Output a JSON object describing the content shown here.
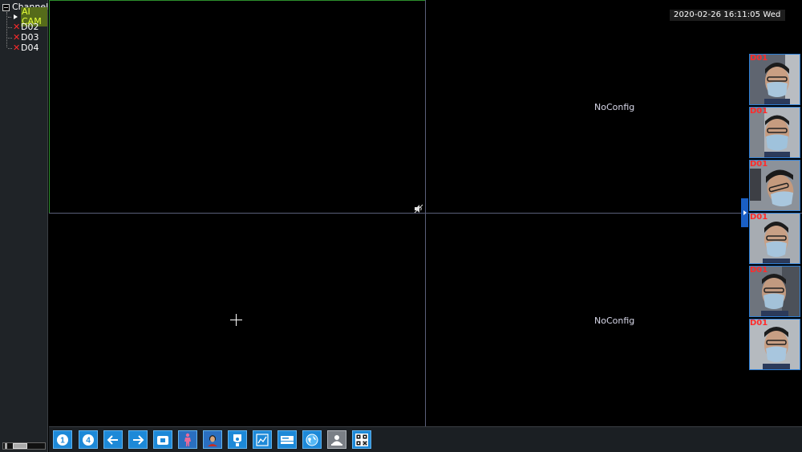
{
  "sidebar": {
    "root_label": "Channel",
    "items": [
      {
        "label": "AI CAM",
        "status": "active"
      },
      {
        "label": "D02",
        "status": "offline"
      },
      {
        "label": "D03",
        "status": "offline"
      },
      {
        "label": "D04",
        "status": "offline"
      }
    ]
  },
  "overlay": {
    "datetime": "2020-02-26 16:11:05 Wed"
  },
  "panes": {
    "top_right": "NoConfig",
    "bottom_right": "NoConfig"
  },
  "faces": [
    {
      "label": "D01"
    },
    {
      "label": "D01"
    },
    {
      "label": "D01"
    },
    {
      "label": "D01"
    },
    {
      "label": "D01"
    },
    {
      "label": "D01"
    }
  ],
  "toolbar": {
    "buttons": [
      {
        "name": "single-view-button",
        "text": "1"
      },
      {
        "name": "quad-view-button",
        "text": "4"
      },
      {
        "name": "previous-button",
        "icon": "arrow-left-icon"
      },
      {
        "name": "next-button",
        "icon": "arrow-right-icon"
      },
      {
        "name": "stop-button",
        "icon": "stop-icon"
      },
      {
        "name": "human-detect-button",
        "icon": "person-icon"
      },
      {
        "name": "face-detect-button",
        "icon": "face-icon"
      },
      {
        "name": "ptz-button",
        "icon": "camera-icon"
      },
      {
        "name": "chart-button",
        "icon": "chart-icon"
      },
      {
        "name": "record-button",
        "icon": "dvr-icon"
      },
      {
        "name": "network-button",
        "icon": "globe-icon"
      },
      {
        "name": "user-button",
        "icon": "user-icon"
      },
      {
        "name": "qr-code-button",
        "icon": "qr-code-icon"
      }
    ]
  },
  "colors": {
    "selected_pane_border": "#2c8f2c",
    "grid_line": "#5a5f7a",
    "offline_mark": "#ff2a2a",
    "selected_channel_bg": "#556b1a",
    "selected_channel_text": "#e7ff3a",
    "toolbar_button": "#1d89d8",
    "face_border": "#2d7fd6"
  }
}
